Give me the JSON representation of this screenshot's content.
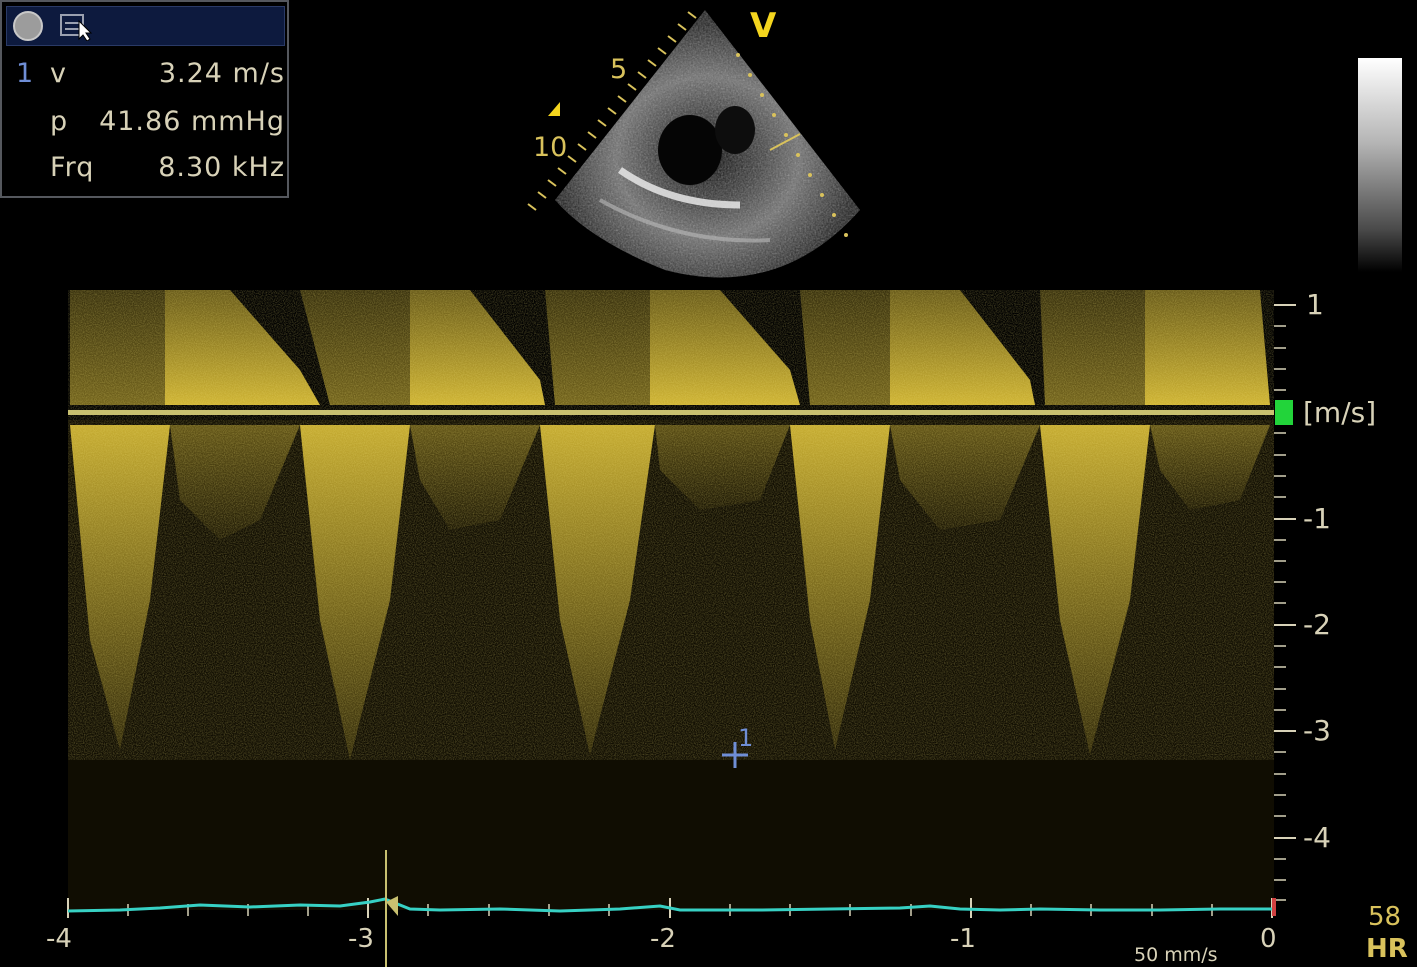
{
  "panel": {
    "icons": [
      "record-icon",
      "measure-tool-icon"
    ],
    "measurement_index": "1",
    "rows": [
      {
        "key": "v",
        "value": "3.24 m/s"
      },
      {
        "key": "p",
        "value": "41.86 mmHg"
      },
      {
        "key": "Frq",
        "value": "8.30 kHz"
      }
    ]
  },
  "sector": {
    "view_label": "V",
    "depth_labels": [
      "5",
      "10"
    ]
  },
  "doppler": {
    "velocity_unit": "[m/s]",
    "velocity_ticks": [
      "1",
      "-1",
      "-2",
      "-3",
      "-4"
    ],
    "time_ticks": [
      "-4",
      "-3",
      "-2",
      "-1",
      "0"
    ],
    "sweep_speed": "50 mm/s",
    "heart_rate": "58",
    "heart_rate_label": "HR",
    "cursor_label": "1"
  },
  "colors": {
    "doppler": "#e6c83a",
    "baseline": "#c8c070",
    "ecg": "#37d1c4",
    "caliper": "#6f8ed6",
    "baseline_marker": "#22d43a"
  }
}
